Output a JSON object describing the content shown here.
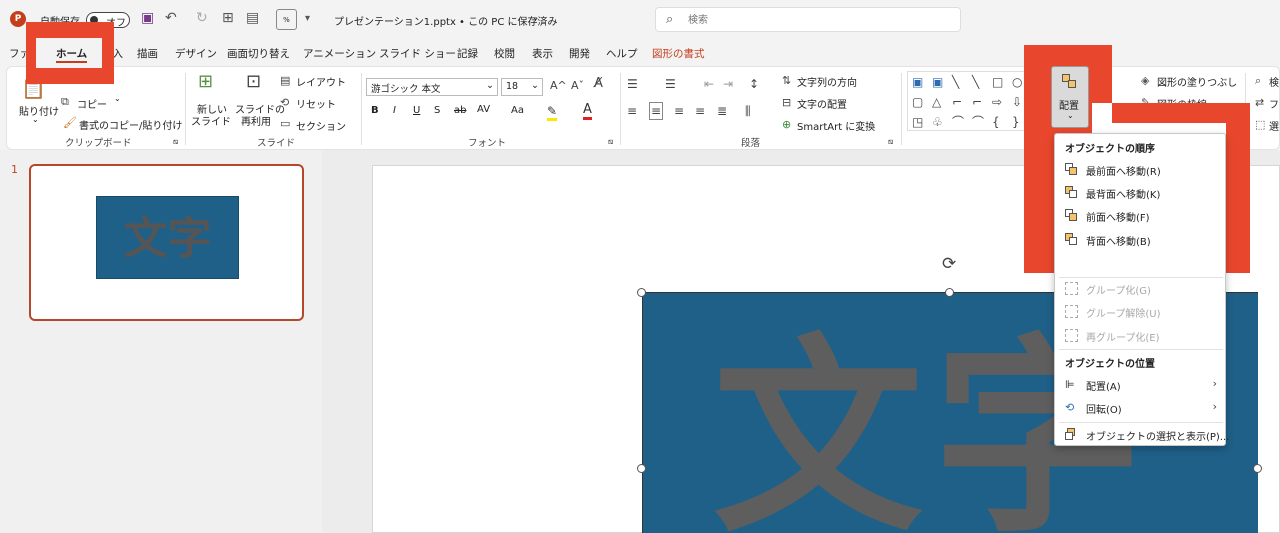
{
  "titlebar": {
    "autosave_label": "自動保存",
    "autosave_state": "オフ",
    "file_title": "プレゼンテーション1.pptx • この PC に保存済み",
    "search_placeholder": "検索"
  },
  "tabs": [
    "ファイル",
    "ホーム",
    "挿入",
    "描画",
    "デザイン",
    "画面切り替え",
    "アニメーション",
    "スライド ショー",
    "記録",
    "校閲",
    "表示",
    "開発",
    "ヘルプ",
    "図形の書式"
  ],
  "ribbon": {
    "clipboard": {
      "paste": "貼り付け",
      "copy": "コピー",
      "format_painter": "書式のコピー/貼り付け",
      "group": "クリップボード"
    },
    "slides": {
      "new_slide_1": "新しい",
      "new_slide_2": "スライド",
      "reuse_1": "スライドの",
      "reuse_2": "再利用",
      "layout": "レイアウト",
      "reset": "リセット",
      "section": "セクション",
      "group": "スライド"
    },
    "font": {
      "font_name": "游ゴシック 本文",
      "font_size": "18",
      "bold": "B",
      "italic": "I",
      "underline": "U",
      "shadow": "S",
      "strike": "ab",
      "spacing": "AV",
      "case": "Aa",
      "group": "フォント"
    },
    "paragraph": {
      "text_direction": "文字列の方向",
      "align_text": "文字の配置",
      "smartart": "SmartArt に変換",
      "group": "段落"
    },
    "drawing": {
      "arrange": "配置",
      "shape_fill": "図形の塗りつぶし",
      "shape_outline": "図形の枠線",
      "find": "検",
      "replace": "ファ",
      "select": "選"
    }
  },
  "slide_panel": {
    "slide_number": "1",
    "thumb_text": "文字"
  },
  "slide": {
    "shape_text": "文字"
  },
  "arrange_menu": {
    "order_header": "オブジェクトの順序",
    "order_items": [
      "最前面へ移動(R)",
      "最背面へ移動(K)",
      "前面へ移動(F)",
      "背面へ移動(B)"
    ],
    "group_items": [
      "グループ化(G)",
      "グループ解除(U)",
      "再グループ化(E)"
    ],
    "position_header": "オブジェクトの位置",
    "position_items": [
      "配置(A)",
      "回転(O)"
    ],
    "selection_pane": "オブジェクトの選択と表示(P)..."
  },
  "colors": {
    "accent": "#c43e1c",
    "highlight": "#e8472d",
    "shape_fill": "#1f6088"
  }
}
